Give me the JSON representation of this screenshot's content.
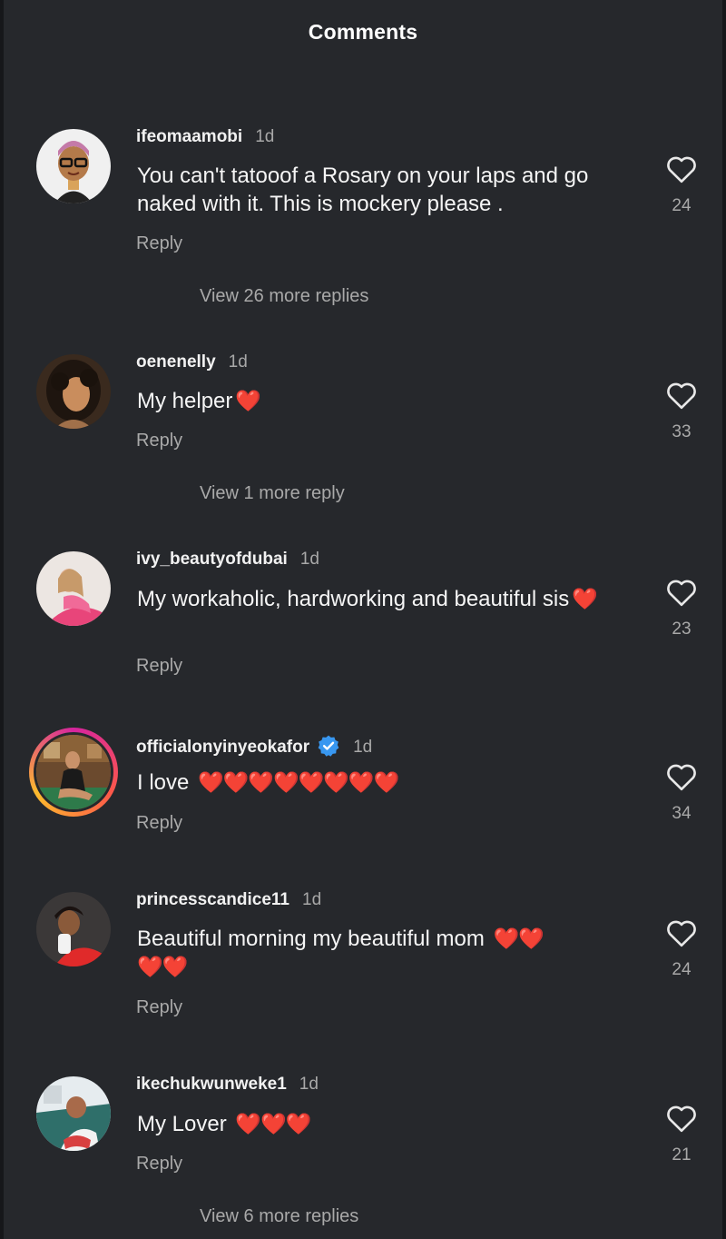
{
  "header": {
    "title": "Comments"
  },
  "comments": [
    {
      "username": "ifeomaamobi",
      "time": "1d",
      "text": "You can't tatooof a Rosary on your laps and go naked with it. This is mockery please .",
      "hearts": "",
      "reply_label": "Reply",
      "likes": "24",
      "more_replies": "View 26 more replies",
      "verified": false,
      "avatar_icon": "avatar-bitmoji-icon"
    },
    {
      "username": "oenenelly",
      "time": "1d",
      "text": "My helper",
      "hearts": "❤️",
      "reply_label": "Reply",
      "likes": "33",
      "more_replies": "View 1 more reply",
      "verified": false,
      "avatar_icon": "avatar-photo-icon"
    },
    {
      "username": "ivy_beautyofdubai",
      "time": "1d",
      "text": "My workaholic, hardworking and beautiful sis",
      "hearts": "❤️",
      "reply_label": "Reply",
      "likes": "23",
      "more_replies": "",
      "verified": false,
      "avatar_icon": "avatar-photo-icon"
    },
    {
      "username": "officialonyinyeokafor",
      "time": "1d",
      "text": "I love",
      "hearts": "❤️❤️❤️❤️❤️❤️❤️❤️",
      "reply_label": "Reply",
      "likes": "34",
      "more_replies": "",
      "verified": true,
      "avatar_icon": "avatar-story-ring-icon"
    },
    {
      "username": "princesscandice11",
      "time": "1d",
      "text": "Beautiful morning my beautiful mom",
      "hearts": "❤️❤️",
      "hearts2": "❤️❤️",
      "reply_label": "Reply",
      "likes": "24",
      "more_replies": "",
      "verified": false,
      "avatar_icon": "avatar-photo-icon"
    },
    {
      "username": "ikechukwunweke1",
      "time": "1d",
      "text": "My Lover",
      "hearts": "❤️❤️❤️",
      "reply_label": "Reply",
      "likes": "21",
      "more_replies": "View 6 more replies",
      "verified": false,
      "avatar_icon": "avatar-photo-icon"
    }
  ],
  "colors": {
    "background": "#26282c",
    "heart": "#ff2d3a",
    "verified": "#3897f0",
    "muted": "#a9a9a9"
  }
}
